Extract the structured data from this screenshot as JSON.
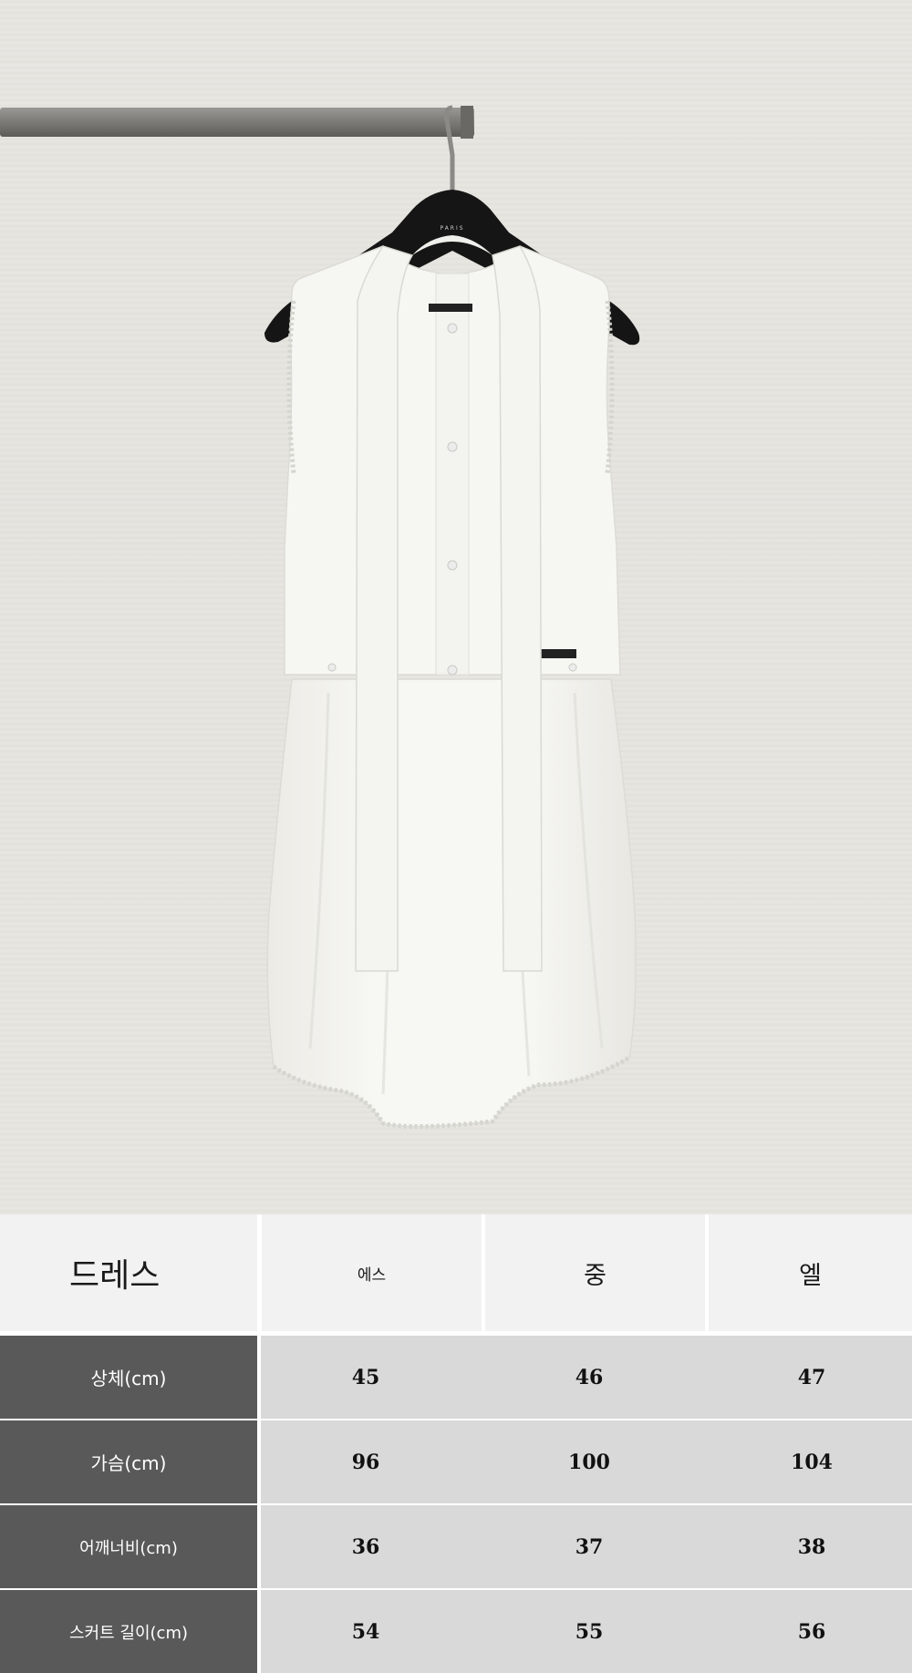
{
  "product_photo": {
    "subject": "hanger-icon",
    "hanger_brand_text": "PARIS"
  },
  "size_table": {
    "title": "드레스",
    "sizes": [
      "에스",
      "중",
      "엘"
    ],
    "rows": [
      {
        "label": "상체(cm)",
        "values": [
          "45",
          "46",
          "47"
        ]
      },
      {
        "label": "가슴(cm)",
        "values": [
          "96",
          "100",
          "104"
        ]
      },
      {
        "label": "어깨너비(cm)",
        "values": [
          "36",
          "37",
          "38"
        ]
      },
      {
        "label": "스커트 길이(cm)",
        "values": [
          "54",
          "55",
          "56"
        ]
      }
    ]
  },
  "colors": {
    "header_bg": "#f2f2f2",
    "label_bg": "#595959",
    "value_bg": "#d9d9d9",
    "wall": "#e6e4df",
    "dress": "#f6f6f2"
  }
}
